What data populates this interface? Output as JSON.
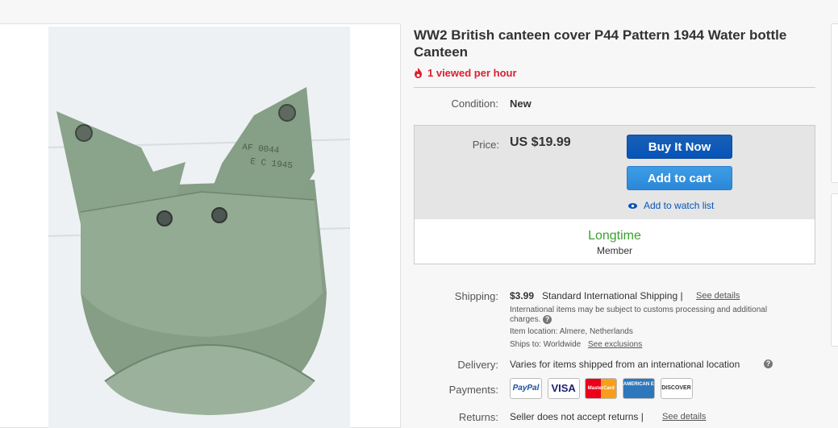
{
  "listing": {
    "title": "WW2 British canteen cover P44 Pattern 1944 Water bottle Canteen",
    "viewed": "1 viewed per hour",
    "image_text": [
      "AF 0044",
      "E C 1945"
    ]
  },
  "condition": {
    "label": "Condition:",
    "value": "New"
  },
  "price": {
    "label": "Price:",
    "value": "US $19.99",
    "buy_now": "Buy It Now",
    "add_to_cart": "Add to cart",
    "watch": "Add to watch list"
  },
  "seller": {
    "longtime": "Longtime",
    "member": "Member"
  },
  "shipping": {
    "label": "Shipping:",
    "cost": "$3.99",
    "method": "Standard International Shipping |",
    "see_details": "See details",
    "note": "International items may be subject to customs processing and additional charges.",
    "location_label": "Item location:",
    "location": "Almere, Netherlands",
    "ships_to_label": "Ships to:",
    "ships_to": "Worldwide",
    "exclusions": "See exclusions"
  },
  "delivery": {
    "label": "Delivery:",
    "value": "Varies for items shipped from an international location"
  },
  "payments": {
    "label": "Payments:",
    "methods": [
      "PayPal",
      "VISA",
      "MasterCard",
      "AMERICAN EXPRESS",
      "DISCOVER"
    ]
  },
  "returns": {
    "label": "Returns:",
    "value": "Seller does not accept returns |",
    "see_details": "See details"
  },
  "colors": {
    "alert_red": "#dd1e31",
    "buy_blue": "#0654ba",
    "cart_blue": "#3d9de6",
    "seller_green": "#3ba12f"
  }
}
